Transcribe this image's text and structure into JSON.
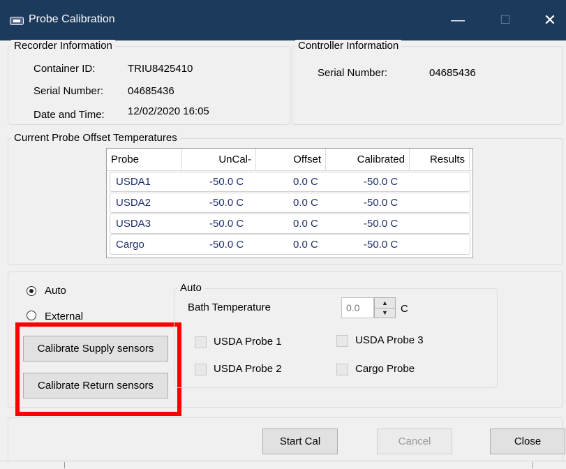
{
  "window": {
    "title": "Probe Calibration",
    "icon": "probe-app-icon",
    "min": "—",
    "max": "☐",
    "close": "✕"
  },
  "recorder": {
    "legend": "Recorder Information",
    "container_label": "Container ID:",
    "container_value": "TRIU8425410",
    "serial_label": "Serial Number:",
    "serial_value": "04685436",
    "datetime_label": "Date and Time:",
    "datetime_value": "12/02/2020 16:05"
  },
  "controller": {
    "legend": "Controller Information",
    "serial_label": "Serial Number:",
    "serial_value": "04685436"
  },
  "offsets": {
    "legend": "Current Probe Offset Temperatures",
    "headers": [
      "Probe",
      "UnCal-",
      "Offset",
      "Calibrated",
      "Results"
    ],
    "rows": [
      {
        "probe": "USDA1",
        "uncal": "-50.0 C",
        "offset": "0.0 C",
        "calibrated": "-50.0 C",
        "results": ""
      },
      {
        "probe": "USDA2",
        "uncal": "-50.0 C",
        "offset": "0.0 C",
        "calibrated": "-50.0 C",
        "results": ""
      },
      {
        "probe": "USDA3",
        "uncal": "-50.0 C",
        "offset": "0.0 C",
        "calibrated": "-50.0 C",
        "results": ""
      },
      {
        "probe": "Cargo",
        "uncal": "-50.0 C",
        "offset": "0.0 C",
        "calibrated": "-50.0 C",
        "results": ""
      }
    ]
  },
  "mode": {
    "auto_label": "Auto",
    "external_label": "External",
    "selected": "Auto"
  },
  "calibrate": {
    "supply_label": "Calibrate Supply sensors",
    "return_label": "Calibrate Return sensors"
  },
  "auto_group": {
    "legend": "Auto",
    "bath_label": "Bath Temperature",
    "bath_value": "0.0",
    "bath_unit": "C",
    "probes": {
      "usda1": "USDA Probe 1",
      "usda2": "USDA Probe 2",
      "usda3": "USDA Probe 3",
      "cargo": "Cargo Probe"
    }
  },
  "actions": {
    "start": "Start Cal",
    "cancel": "Cancel",
    "close": "Close"
  },
  "colors": {
    "titlebar": "#1b3a5c",
    "highlight": "#ff0000",
    "table_text": "#1f2f6b"
  }
}
